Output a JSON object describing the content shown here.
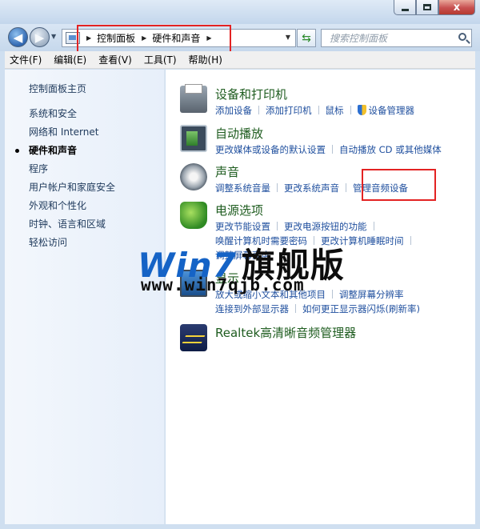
{
  "window": {
    "close_label": "x"
  },
  "address_bar": {
    "crumbs": [
      "控制面板",
      "硬件和声音"
    ],
    "search_placeholder": "搜索控制面板"
  },
  "menu": [
    "文件(F)",
    "编辑(E)",
    "查看(V)",
    "工具(T)",
    "帮助(H)"
  ],
  "sidebar": {
    "home": "控制面板主页",
    "items": [
      {
        "label": "系统和安全"
      },
      {
        "label": "网络和 Internet"
      },
      {
        "label": "硬件和声音",
        "current": true
      },
      {
        "label": "程序"
      },
      {
        "label": "用户帐户和家庭安全"
      },
      {
        "label": "外观和个性化"
      },
      {
        "label": "时钟、语言和区域"
      },
      {
        "label": "轻松访问"
      }
    ]
  },
  "categories": {
    "devices": {
      "title": "设备和打印机",
      "links": [
        "添加设备",
        "添加打印机",
        "鼠标",
        "设备管理器"
      ]
    },
    "autoplay": {
      "title": "自动播放",
      "links": [
        "更改媒体或设备的默认设置",
        "自动播放 CD 或其他媒体"
      ]
    },
    "sound": {
      "title": "声音",
      "links": [
        "调整系统音量",
        "更改系统声音",
        "管理音频设备"
      ]
    },
    "power": {
      "title": "电源选项",
      "links": [
        "更改节能设置",
        "更改电源按钮的功能",
        "唤醒计算机时需要密码",
        "更改计算机睡眠时间",
        "调整屏幕亮度"
      ]
    },
    "display": {
      "title": "显示",
      "links": [
        "放大或缩小文本和其他项目",
        "调整屏幕分辨率",
        "连接到外部显示器",
        "如何更正显示器闪烁(刷新率)"
      ]
    },
    "realtek": {
      "title": "Realtek高清晰音频管理器"
    }
  },
  "watermark": {
    "brand": "Win7",
    "brand_cn": "旗舰版",
    "url": "www.win7qjb.com"
  },
  "colors": {
    "category_title": "#1e5c1f",
    "link": "#1f4f9e",
    "highlight_box": "#e32323"
  }
}
